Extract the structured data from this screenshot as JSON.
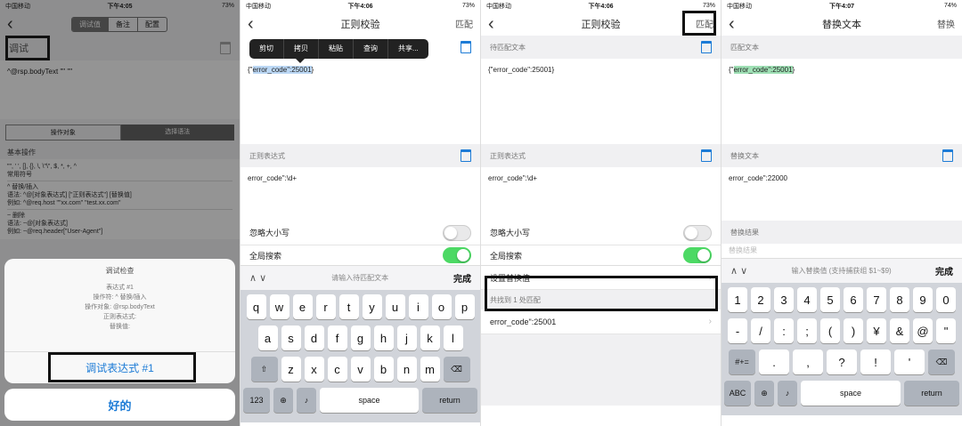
{
  "p1": {
    "status": {
      "carrier": "中国移动",
      "time": "下午4:05",
      "battery": "73%"
    },
    "seg": [
      "调试值",
      "备注",
      "配置"
    ],
    "title": "调试",
    "text": "^@rsp.bodyText \"\" \"\"",
    "tabs": [
      "操作对象",
      "选择语法"
    ],
    "basic_header": "基本操作",
    "basic": [
      {
        "line1": "\"\", ' ', [], {}, \\, \\\"\\\", $, *, +, ^",
        "line2": "常用符号"
      },
      {
        "line1": "^ 替换/插入",
        "line2": "语法: ^@[对象表达式] [\"正则表达式\"] [替换值]",
        "line3": "例如: ^@req.host \"\"xx.com\" \"test.xx.com\""
      },
      {
        "line1": "~ 删除",
        "line2": "语法: ~@[对象表达式]",
        "line3": "例如: ~@req.header[\"User-Agent\"]"
      }
    ],
    "sheet": {
      "title": "调试检查",
      "lines": [
        "表达式 #1",
        "操作符: ^ 替换/插入",
        "操作对象: @rsp.bodyText",
        "正则表达式:",
        "替换值:"
      ],
      "button": "调试表达式 #1"
    },
    "ok": "好的"
  },
  "p2": {
    "status": {
      "carrier": "中国移动",
      "time": "下午4:06",
      "battery": "73%"
    },
    "title": "正则校验",
    "match_btn": "匹配",
    "menu": [
      "剪切",
      "拷贝",
      "粘贴",
      "查询",
      "共享..."
    ],
    "text_prefix": "{\"",
    "text_sel": "error_code\":25001",
    "text_suffix": "}",
    "regex_header": "正则表达式",
    "regex": "error_code\":\\d+",
    "ignore_case": "忽略大小写",
    "global": "全局搜索",
    "placeholder": "请输入待匹配文本",
    "done": "完成",
    "keys_row1": [
      "q",
      "w",
      "e",
      "r",
      "t",
      "y",
      "u",
      "i",
      "o",
      "p"
    ],
    "keys_row2": [
      "a",
      "s",
      "d",
      "f",
      "g",
      "h",
      "j",
      "k",
      "l"
    ],
    "keys_row3": [
      "z",
      "x",
      "c",
      "v",
      "b",
      "n",
      "m"
    ],
    "k123": "123",
    "space": "space",
    "return": "return"
  },
  "p3": {
    "status": {
      "carrier": "中国移动",
      "time": "下午4:06",
      "battery": "73%"
    },
    "title": "正则校验",
    "match_btn": "匹配",
    "text_header": "待匹配文本",
    "text": "{\"error_code\":25001}",
    "regex_header": "正则表达式",
    "regex": "error_code\":\\d+",
    "ignore_case": "忽略大小写",
    "global": "全局搜索",
    "set_replace": "设置替换值",
    "found": "共找到 1 处匹配",
    "match": "error_code\":25001"
  },
  "p4": {
    "status": {
      "carrier": "中国移动",
      "time": "下午4:07",
      "battery": "74%"
    },
    "title": "替换文本",
    "replace_btn": "替换",
    "match_header": "匹配文本",
    "text_prefix": "{\"",
    "text_hl": "error_code\":25001",
    "text_suffix": "}",
    "replace_header": "替换文本",
    "replace": "error_code\":22000",
    "result_header": "替换结果",
    "result_placeholder": "替换结果",
    "placeholder": "输入替换值 (支持捕获组 $1~$9)",
    "done": "完成",
    "keys_row1": [
      "1",
      "2",
      "3",
      "4",
      "5",
      "6",
      "7",
      "8",
      "9",
      "0"
    ],
    "keys_row2": [
      "-",
      "/",
      ":",
      ";",
      "(",
      ")",
      "¥",
      "&",
      "@",
      "\""
    ],
    "keys_row3": [
      ".",
      ",",
      "?",
      "!",
      "'"
    ],
    "k_sym": "#+=",
    "k_abc": "ABC",
    "space": "space",
    "return": "return"
  }
}
